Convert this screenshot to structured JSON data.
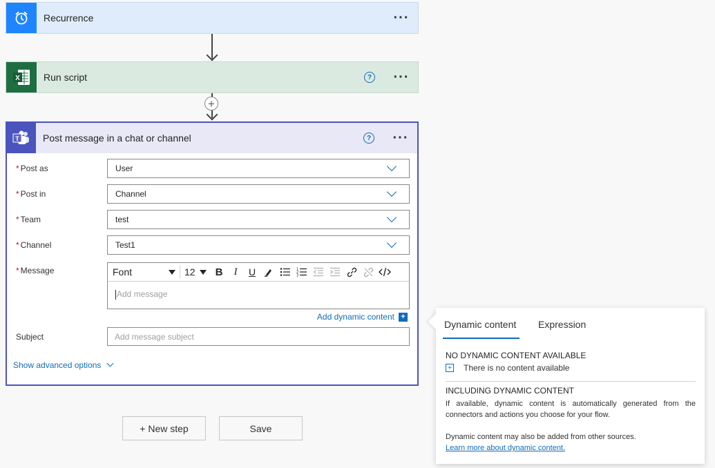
{
  "colors": {
    "recurrence_icon_bg": "#1f85ff",
    "recurrence_card_bg": "#deecfb",
    "excel_icon_bg": "#1d6f42",
    "excel_card_bg": "#dbeae1",
    "teams_icon_bg": "#4b53bc",
    "teams_card_bg": "#e8e8f7",
    "teams_card_border": "#4b53bc",
    "accent": "#0f6cbd",
    "required": "#a4262c"
  },
  "steps": {
    "recurrence": {
      "title": "Recurrence",
      "icon": "alarm-clock-icon",
      "more": "···"
    },
    "run_script": {
      "title": "Run script",
      "icon": "excel-icon",
      "help": "?",
      "more": "···"
    },
    "post_message": {
      "title": "Post message in a chat or channel",
      "icon": "teams-icon",
      "help": "?",
      "more": "···"
    }
  },
  "insert_step": {
    "symbol": "+"
  },
  "form": {
    "required_mark": "*",
    "post_as": {
      "label": "Post as",
      "value": "User"
    },
    "post_in": {
      "label": "Post in",
      "value": "Channel"
    },
    "team": {
      "label": "Team",
      "value": "test"
    },
    "channel": {
      "label": "Channel",
      "value": "Test1"
    },
    "message": {
      "label": "Message",
      "font": "Font",
      "font_size": "12",
      "toolbar": [
        "bold",
        "italic",
        "underline",
        "highlight",
        "bullet-list",
        "numbered-list",
        "decrease-indent",
        "increase-indent",
        "link",
        "unlink",
        "code-view"
      ],
      "placeholder": "Add message"
    },
    "add_dynamic_content": "Add dynamic content",
    "subject": {
      "label": "Subject",
      "placeholder": "Add message subject"
    },
    "show_advanced": "Show advanced options"
  },
  "buttons": {
    "new_step": "+ New step",
    "save": "Save"
  },
  "dynamic_panel": {
    "tabs": [
      "Dynamic content",
      "Expression"
    ],
    "active_tab": "Dynamic content",
    "no_content_heading": "NO DYNAMIC CONTENT AVAILABLE",
    "no_content_text": "There is no content available",
    "including_heading": "INCLUDING DYNAMIC CONTENT",
    "including_text": "If available, dynamic content is automatically generated from the connectors and actions you choose for your flow.",
    "other_sources_text": "Dynamic content may also be added from other sources.",
    "learn_more": "Learn more about dynamic content."
  }
}
